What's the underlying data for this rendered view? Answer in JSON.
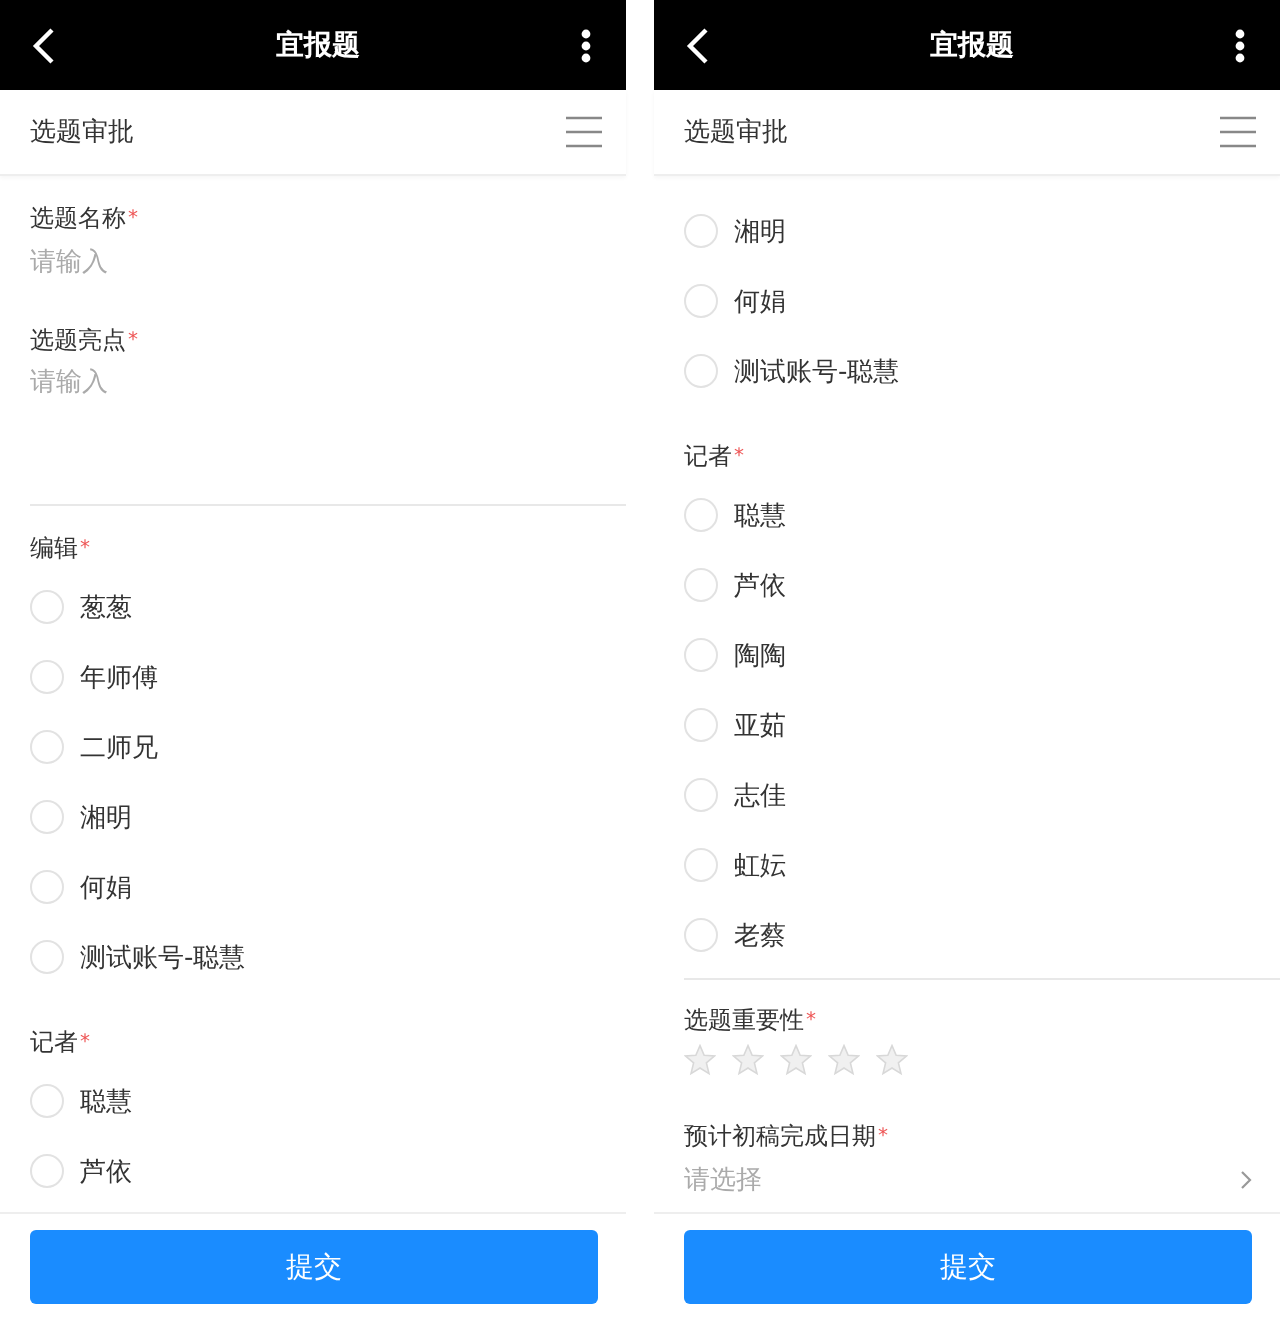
{
  "screens": [
    {
      "title": "宜报题",
      "section": "选题审批",
      "blocks": [
        {
          "kind": "field",
          "label": "选题名称",
          "required_mark": "*",
          "placeholder": "请输入",
          "tall": false
        },
        {
          "kind": "field",
          "label": "选题亮点",
          "required_mark": "*",
          "placeholder": "请输入",
          "tall": true
        },
        {
          "kind": "radio-group",
          "label": "编辑",
          "required_mark": "*",
          "options": [
            {
              "label": "葱葱",
              "selected": false
            },
            {
              "label": "年师傅",
              "selected": false
            },
            {
              "label": "二师兄",
              "selected": false
            },
            {
              "label": "湘明",
              "selected": false
            },
            {
              "label": "何娟",
              "selected": false
            },
            {
              "label": "测试账号-聪慧",
              "selected": false
            }
          ]
        },
        {
          "kind": "radio-group",
          "label": "记者",
          "required_mark": "*",
          "options": [
            {
              "label": "聪慧",
              "selected": false
            },
            {
              "label": "芦依",
              "selected": false
            }
          ]
        }
      ],
      "submit": "提交"
    },
    {
      "title": "宜报题",
      "section": "选题审批",
      "blocks": [
        {
          "kind": "radio-group",
          "options": [
            {
              "label": "湘明",
              "selected": false
            },
            {
              "label": "何娟",
              "selected": false
            },
            {
              "label": "测试账号-聪慧",
              "selected": false
            }
          ]
        },
        {
          "kind": "radio-group",
          "label": "记者",
          "required_mark": "*",
          "options": [
            {
              "label": "聪慧",
              "selected": false
            },
            {
              "label": "芦依",
              "selected": false
            },
            {
              "label": "陶陶",
              "selected": false
            },
            {
              "label": "亚茹",
              "selected": false
            },
            {
              "label": "志佳",
              "selected": false
            },
            {
              "label": "虹妘",
              "selected": false
            },
            {
              "label": "老蔡",
              "selected": false
            }
          ]
        },
        {
          "kind": "rating",
          "label": "选题重要性",
          "required_mark": "*",
          "stars": 0
        },
        {
          "kind": "date",
          "label": "预计初稿完成日期",
          "required_mark": "*",
          "placeholder": "请选择"
        }
      ],
      "submit": "提交"
    }
  ]
}
